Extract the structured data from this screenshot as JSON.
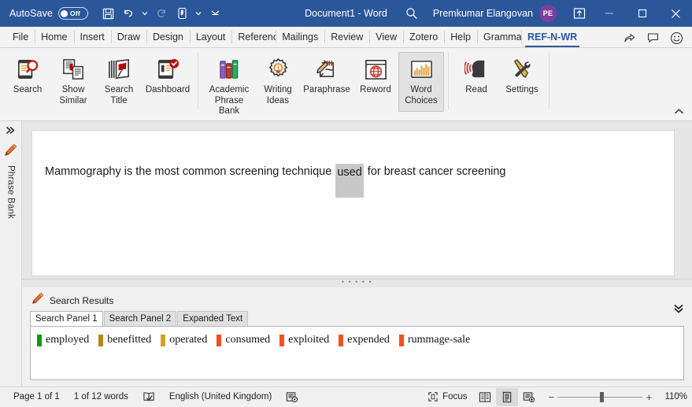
{
  "titlebar": {
    "autosave_label": "AutoSave",
    "autosave_state": "Off",
    "document_title": "Document1  -  Word",
    "user_name": "Premkumar Elangovan",
    "avatar_initials": "PE",
    "qat": [
      {
        "name": "save-button",
        "icon": "save-icon"
      },
      {
        "name": "undo-button",
        "icon": "undo-icon"
      },
      {
        "name": "redo-button",
        "icon": "redo-icon"
      },
      {
        "name": "touch-mode-button",
        "icon": "touch-pointer-icon"
      },
      {
        "name": "customize-qat-button",
        "icon": "chevron-down-icon"
      }
    ],
    "window_buttons": [
      "minimize",
      "maximize",
      "close"
    ]
  },
  "tabs": [
    {
      "label": "File",
      "active": false
    },
    {
      "label": "Home",
      "active": false
    },
    {
      "label": "Insert",
      "active": false
    },
    {
      "label": "Draw",
      "active": false
    },
    {
      "label": "Design",
      "active": false
    },
    {
      "label": "Layout",
      "active": false
    },
    {
      "label": "References",
      "active": false
    },
    {
      "label": "Mailings",
      "active": false
    },
    {
      "label": "Review",
      "active": false
    },
    {
      "label": "View",
      "active": false
    },
    {
      "label": "Zotero",
      "active": false
    },
    {
      "label": "Help",
      "active": false
    },
    {
      "label": "Grammarly",
      "active": false
    },
    {
      "label": "REF-N-WR",
      "active": true
    }
  ],
  "ribbon": {
    "groups": [
      {
        "name": "search-group",
        "items": [
          {
            "label": "Search",
            "icon": "document-search-icon",
            "active": false
          },
          {
            "label": "Show\nSimilar",
            "line1": "Show",
            "line2": "Similar",
            "icon": "show-similar-icon",
            "active": false
          },
          {
            "label": "Search\nTitle",
            "line1": "Search",
            "line2": "Title",
            "icon": "search-title-icon",
            "active": false
          },
          {
            "label": "Dashboard",
            "line1": "Dashboard",
            "line2": "",
            "icon": "dashboard-icon",
            "active": false
          }
        ]
      },
      {
        "name": "writing-tools-group",
        "items": [
          {
            "line1": "Academic",
            "line2": "Phrase Bank",
            "icon": "phrase-bank-icon",
            "active": false
          },
          {
            "line1": "Writing",
            "line2": "Ideas",
            "icon": "lightbulb-gear-icon",
            "active": false
          },
          {
            "line1": "Paraphrase",
            "line2": "",
            "icon": "paraphrase-pencil-icon",
            "active": false
          },
          {
            "line1": "Reword",
            "line2": "",
            "icon": "reword-globe-icon",
            "active": false
          },
          {
            "line1": "Word",
            "line2": "Choices",
            "icon": "word-choices-chart-icon",
            "active": true
          }
        ]
      },
      {
        "name": "tools-group",
        "items": [
          {
            "line1": "Read",
            "line2": "",
            "icon": "read-aloud-icon",
            "active": false
          },
          {
            "line1": "Settings",
            "line2": "",
            "icon": "tools-settings-icon",
            "active": false
          }
        ]
      }
    ],
    "collapse_icon": "chevron-up-icon"
  },
  "taskpane": {
    "expand_icon": "double-chevron-right-icon",
    "pencil_icon": "pencil-icon",
    "label": "Phrase Bank"
  },
  "document": {
    "text_before": "Mammography is the most common screening technique ",
    "selected_word": "used",
    "text_after": " for breast cancer screening"
  },
  "results_panel": {
    "pencil_icon": "pencil-icon",
    "title": "Search Results",
    "collapse_icon": "double-chevron-down-icon",
    "tabs": [
      {
        "label": "Search Panel 1",
        "active": true
      },
      {
        "label": "Search Panel 2",
        "active": false
      },
      {
        "label": "Expanded Text",
        "active": false
      }
    ],
    "choices": [
      {
        "label": "employed",
        "color": "#119911"
      },
      {
        "label": "benefitted",
        "color": "#b8860b"
      },
      {
        "label": "operated",
        "color": "#d1a321"
      },
      {
        "label": "consumed",
        "color": "#f4511e"
      },
      {
        "label": "exploited",
        "color": "#f4511e"
      },
      {
        "label": "expended",
        "color": "#f4511e"
      },
      {
        "label": "rummage-sale",
        "color": "#f4511e"
      }
    ]
  },
  "statusbar": {
    "page": "Page 1 of 1",
    "words": "1 of 12 words",
    "proofing_icon": "proofing-check-icon",
    "language": "English (United Kingdom)",
    "accessibility_icon": "accessibility-icon",
    "focus_label": "Focus",
    "focus_icon": "focus-icon",
    "views": [
      {
        "name": "read-mode-view-button",
        "icon": "read-mode-icon",
        "active": false
      },
      {
        "name": "print-layout-view-button",
        "icon": "print-layout-icon",
        "active": true
      },
      {
        "name": "web-layout-view-button",
        "icon": "web-layout-icon",
        "active": false
      }
    ],
    "zoom_out": "−",
    "zoom_in": "+",
    "zoom_level": "110%"
  },
  "colors": {
    "title_bar": "#2b579a",
    "accent": "#2b579a",
    "selection": "#c8c8c8"
  }
}
